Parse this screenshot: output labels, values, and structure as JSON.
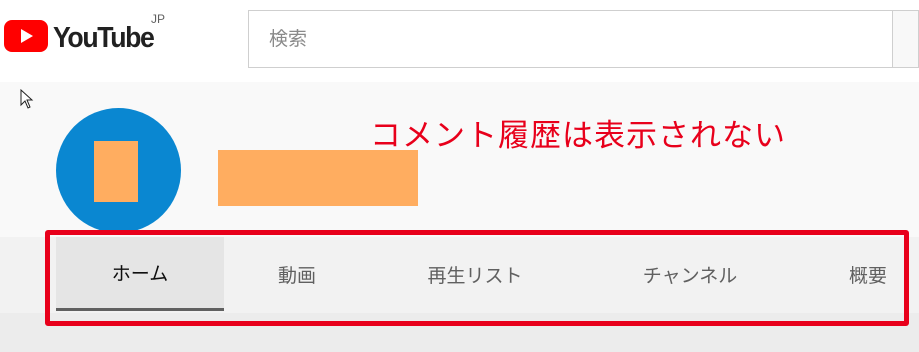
{
  "masthead": {
    "logo_text": "YouTube",
    "region": "JP",
    "search_placeholder": "検索"
  },
  "annotation": {
    "text": "コメント履歴は表示されない",
    "color": "#e8001b"
  },
  "tabs": [
    {
      "label": "ホーム",
      "selected": true
    },
    {
      "label": "動画",
      "selected": false
    },
    {
      "label": "再生リスト",
      "selected": false
    },
    {
      "label": "チャンネル",
      "selected": false
    },
    {
      "label": "概要",
      "selected": false
    }
  ],
  "colors": {
    "brand_red": "#ff0000",
    "avatar_blue": "#0a87d1",
    "redaction_orange": "#ffad60"
  },
  "icons": {
    "logo": "youtube-play-icon",
    "cursor": "mouse-pointer-icon"
  }
}
